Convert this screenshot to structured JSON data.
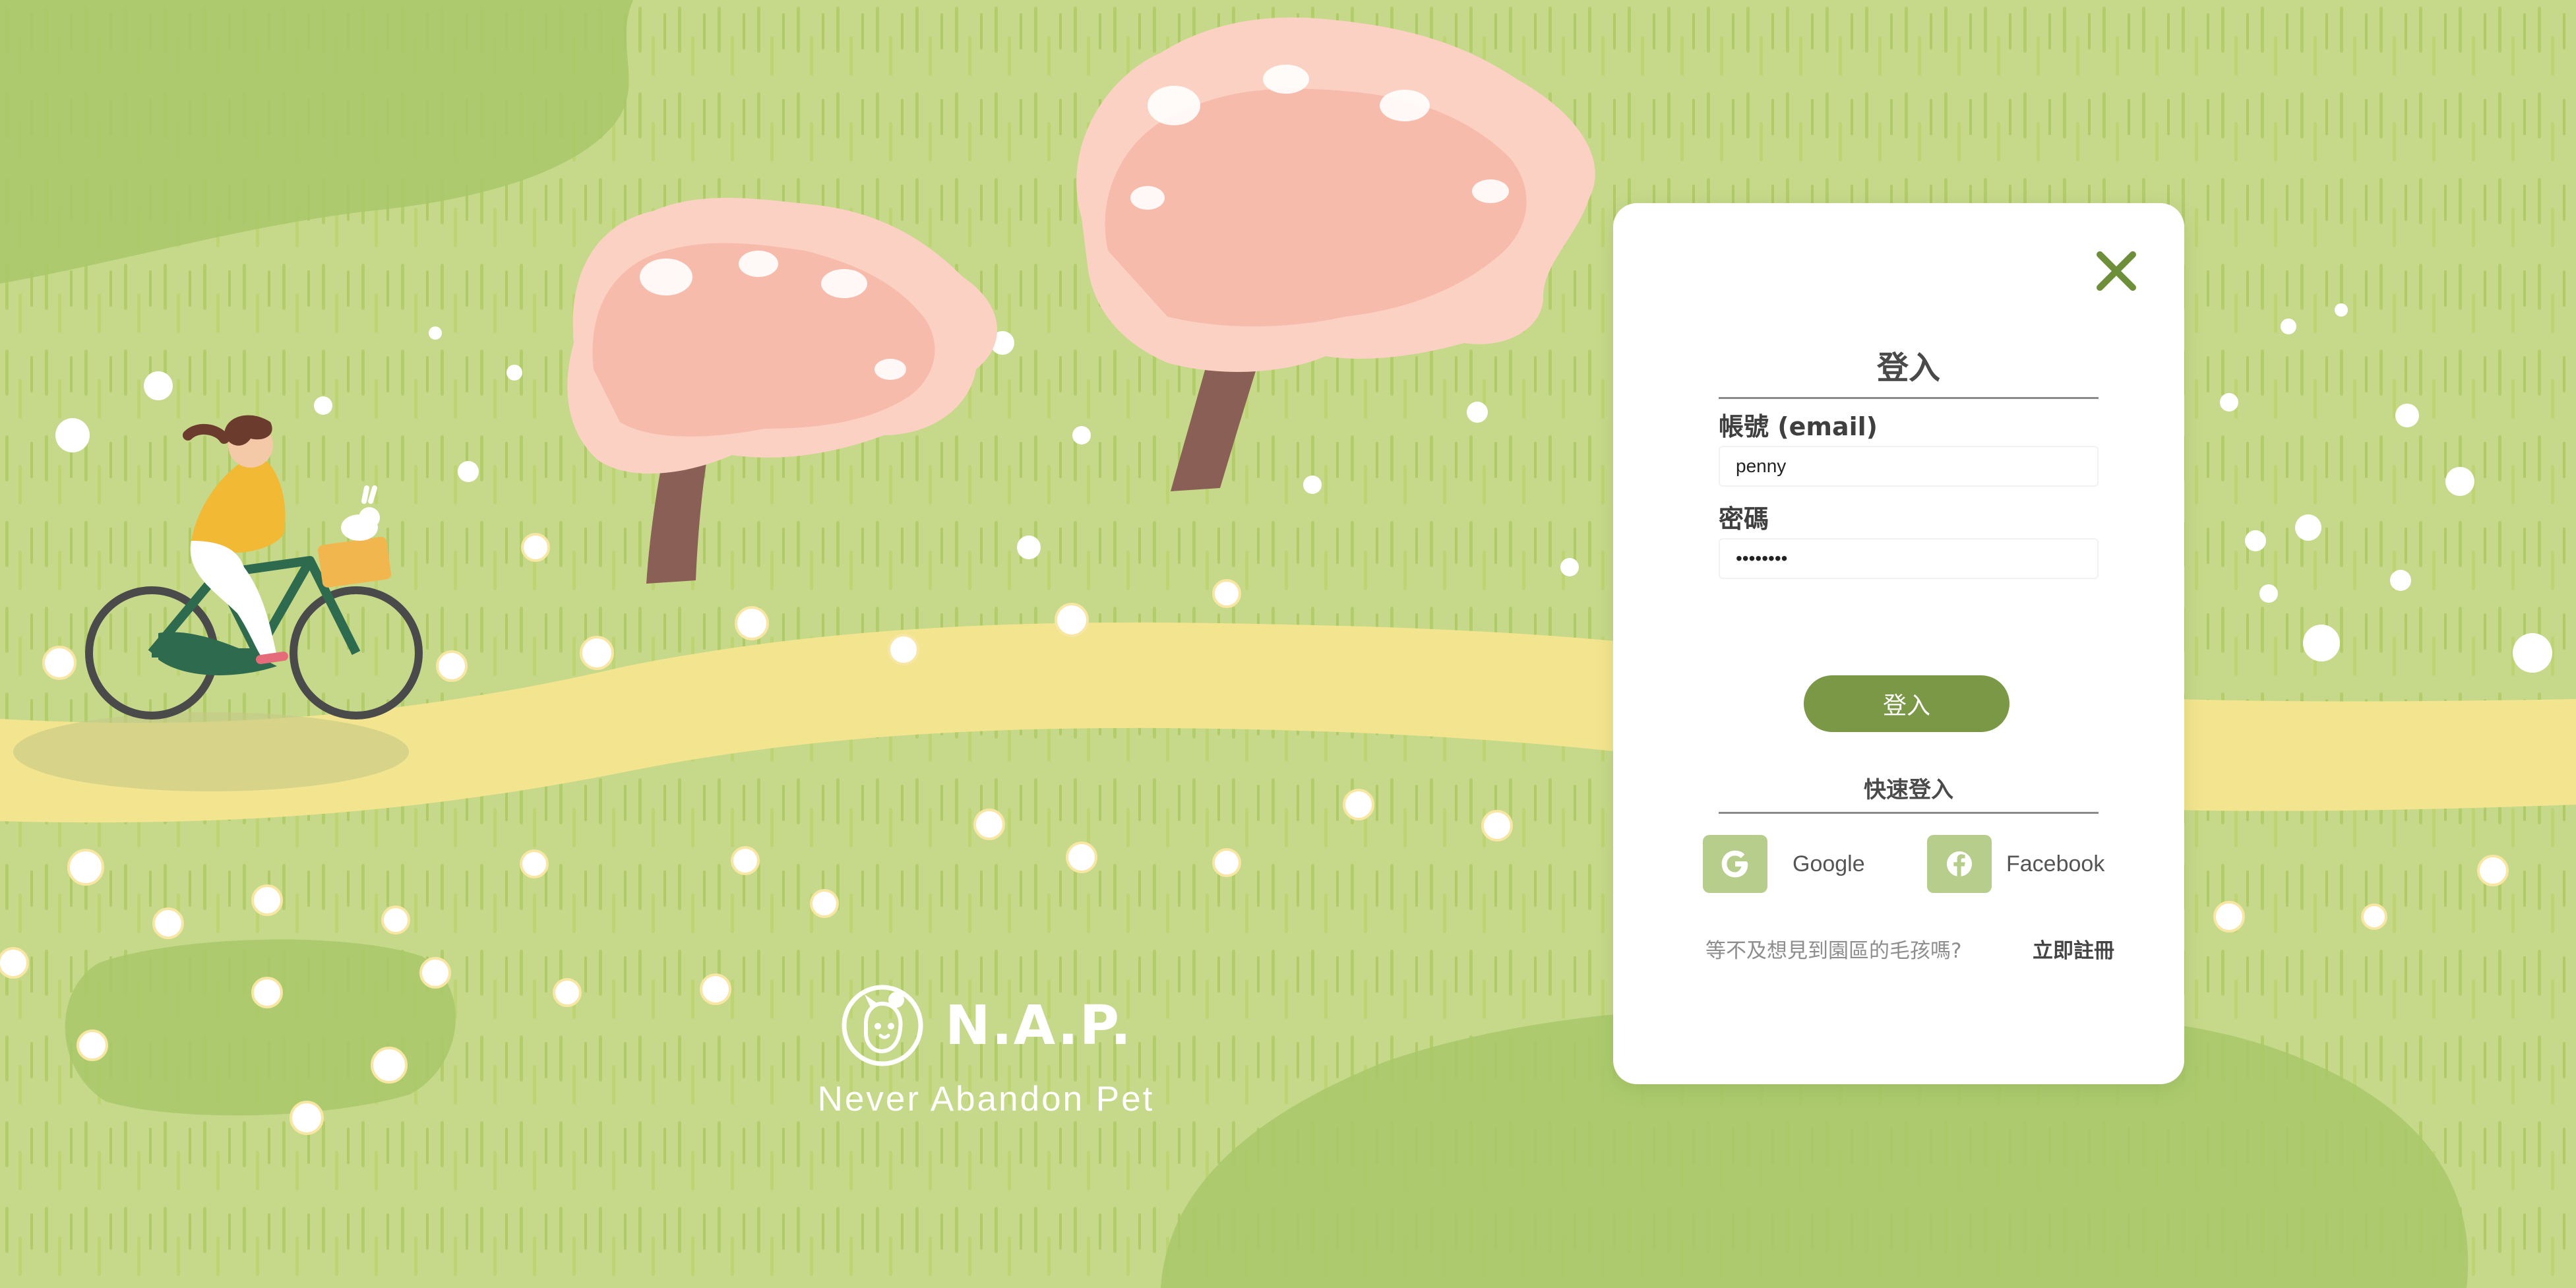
{
  "brand": {
    "name": "N.A.P.",
    "tagline": "Never Abandon Pet"
  },
  "login_modal": {
    "title": "登入",
    "account_label": "帳號 (email)",
    "account_value": "penny",
    "password_label": "密碼",
    "password_value": "penny123",
    "login_button": "登入",
    "quick_login_title": "快速登入",
    "google_label": "Google",
    "facebook_label": "Facebook",
    "signup_prompt": "等不及想見到園區的毛孩嗎?",
    "signup_link": "立即註冊"
  },
  "icons": {
    "close": "close-icon",
    "google": "google-icon",
    "facebook": "facebook-icon",
    "logo": "nap-dog-logo-icon"
  },
  "colors": {
    "background_grass": "#c6d98a",
    "accent_green": "#7a9846",
    "social_icon_bg": "#b7cd8b",
    "path_yellow": "#f3e58f",
    "blossom_pink": "#f9c4b6"
  }
}
